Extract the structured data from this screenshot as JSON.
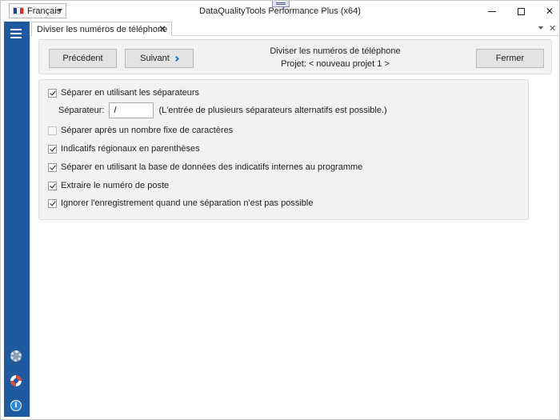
{
  "app": {
    "title": "DataQualityTools Performance Plus (x64)",
    "language": "Français",
    "flag_colors": [
      "#1f3f9e",
      "#ffffff",
      "#e02a2a"
    ]
  },
  "sidebar": {
    "bg_color": "#1f5a9e",
    "icons": [
      "menu-icon",
      "gear-icon",
      "lifebuoy-icon",
      "info-icon"
    ]
  },
  "tab": {
    "label": "Diviser les numéros de téléphone",
    "close_glyph": "✕"
  },
  "toolbar": {
    "prev_label": "Précédent",
    "next_label": "Suivant",
    "close_label": "Fermer",
    "header_title": "Diviser les numéros de téléphone",
    "header_project": "Projet: < nouveau projet 1 >"
  },
  "options": {
    "split_separators": {
      "label": "Séparer en utilisant les séparateurs",
      "checked": true
    },
    "separator": {
      "label": "Séparateur:",
      "value": "/",
      "hint": "(L'entrée de plusieurs séparateurs alternatifs est possible.)"
    },
    "split_fixed": {
      "label": "Séparer après un nombre fixe de caractères",
      "checked": false
    },
    "area_codes_parens": {
      "label": "Indicatifs régionaux en parenthèses",
      "checked": true
    },
    "split_database": {
      "label": "Séparer en utilisant la base de données des indicatifs internes au programme",
      "checked": true
    },
    "extract_extension": {
      "label": "Extraire le numéro de poste",
      "checked": true
    },
    "ignore_record": {
      "label": "Ignorer l'enregistrement quand une séparation n'est pas possible",
      "checked": true
    }
  }
}
